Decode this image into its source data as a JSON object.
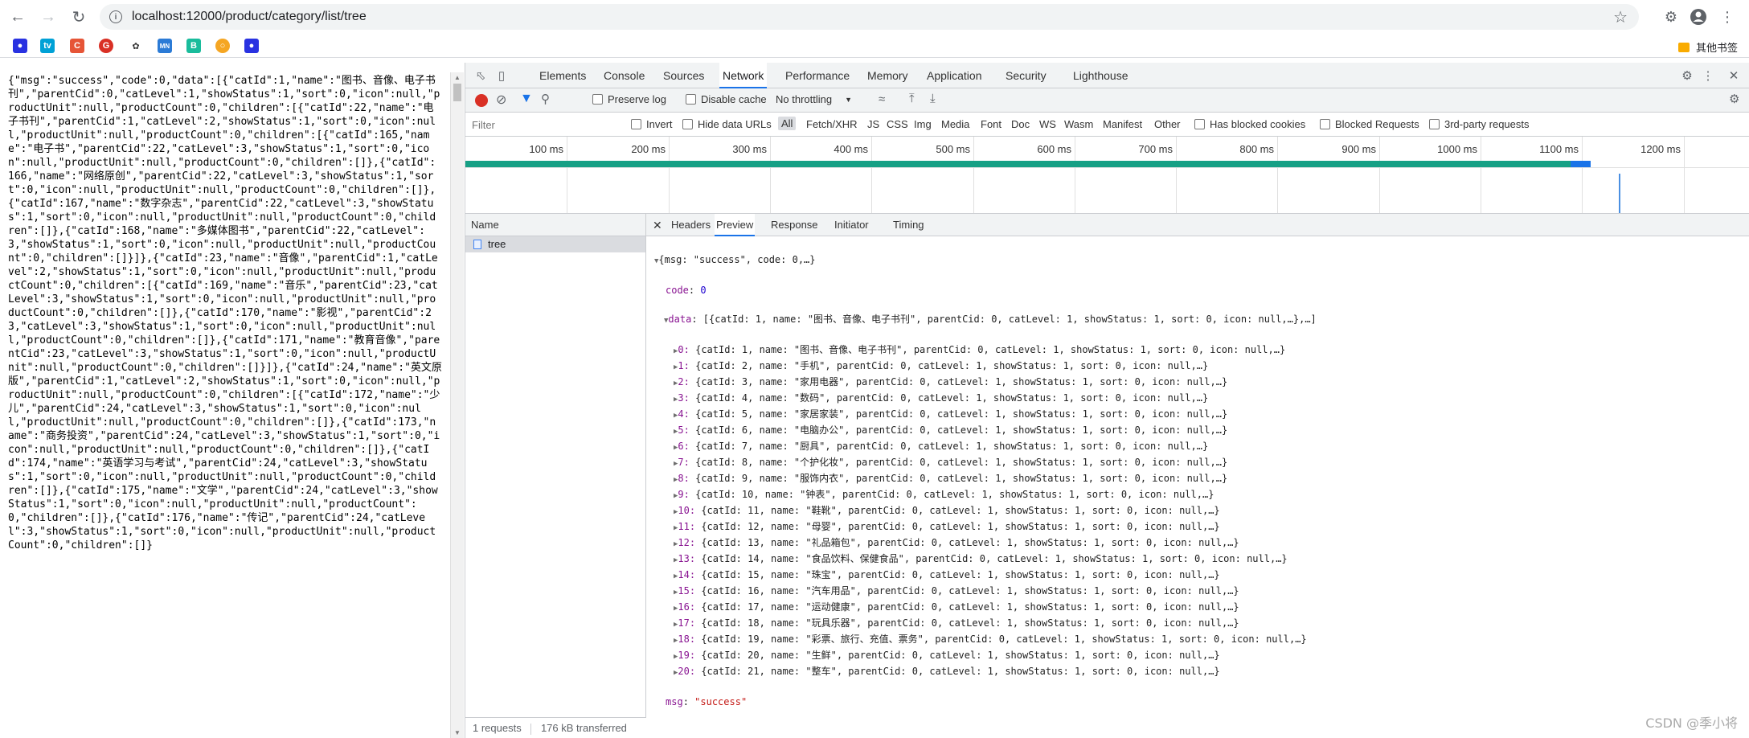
{
  "browser": {
    "url": "localhost:12000/product/category/list/tree",
    "other_bookmarks": "其他书签"
  },
  "page_json_text": "{\"msg\":\"success\",\"code\":0,\"data\":[{\"catId\":1,\"name\":\"图书、音像、电子书刊\",\"parentCid\":0,\"catLevel\":1,\"showStatus\":1,\"sort\":0,\"icon\":null,\"productUnit\":null,\"productCount\":0,\"children\":[{\"catId\":22,\"name\":\"电子书刊\",\"parentCid\":1,\"catLevel\":2,\"showStatus\":1,\"sort\":0,\"icon\":null,\"productUnit\":null,\"productCount\":0,\"children\":[{\"catId\":165,\"name\":\"电子书\",\"parentCid\":22,\"catLevel\":3,\"showStatus\":1,\"sort\":0,\"icon\":null,\"productUnit\":null,\"productCount\":0,\"children\":[]},{\"catId\":166,\"name\":\"网络原创\",\"parentCid\":22,\"catLevel\":3,\"showStatus\":1,\"sort\":0,\"icon\":null,\"productUnit\":null,\"productCount\":0,\"children\":[]},{\"catId\":167,\"name\":\"数字杂志\",\"parentCid\":22,\"catLevel\":3,\"showStatus\":1,\"sort\":0,\"icon\":null,\"productUnit\":null,\"productCount\":0,\"children\":[]},{\"catId\":168,\"name\":\"多媒体图书\",\"parentCid\":22,\"catLevel\":3,\"showStatus\":1,\"sort\":0,\"icon\":null,\"productUnit\":null,\"productCount\":0,\"children\":[]}]},{\"catId\":23,\"name\":\"音像\",\"parentCid\":1,\"catLevel\":2,\"showStatus\":1,\"sort\":0,\"icon\":null,\"productUnit\":null,\"productCount\":0,\"children\":[{\"catId\":169,\"name\":\"音乐\",\"parentCid\":23,\"catLevel\":3,\"showStatus\":1,\"sort\":0,\"icon\":null,\"productUnit\":null,\"productCount\":0,\"children\":[]},{\"catId\":170,\"name\":\"影视\",\"parentCid\":23,\"catLevel\":3,\"showStatus\":1,\"sort\":0,\"icon\":null,\"productUnit\":null,\"productCount\":0,\"children\":[]},{\"catId\":171,\"name\":\"教育音像\",\"parentCid\":23,\"catLevel\":3,\"showStatus\":1,\"sort\":0,\"icon\":null,\"productUnit\":null,\"productCount\":0,\"children\":[]}]},{\"catId\":24,\"name\":\"英文原版\",\"parentCid\":1,\"catLevel\":2,\"showStatus\":1,\"sort\":0,\"icon\":null,\"productUnit\":null,\"productCount\":0,\"children\":[{\"catId\":172,\"name\":\"少儿\",\"parentCid\":24,\"catLevel\":3,\"showStatus\":1,\"sort\":0,\"icon\":null,\"productUnit\":null,\"productCount\":0,\"children\":[]},{\"catId\":173,\"name\":\"商务投资\",\"parentCid\":24,\"catLevel\":3,\"showStatus\":1,\"sort\":0,\"icon\":null,\"productUnit\":null,\"productCount\":0,\"children\":[]},{\"catId\":174,\"name\":\"英语学习与考试\",\"parentCid\":24,\"catLevel\":3,\"showStatus\":1,\"sort\":0,\"icon\":null,\"productUnit\":null,\"productCount\":0,\"children\":[]},{\"catId\":175,\"name\":\"文学\",\"parentCid\":24,\"catLevel\":3,\"showStatus\":1,\"sort\":0,\"icon\":null,\"productUnit\":null,\"productCount\":0,\"children\":[]},{\"catId\":176,\"name\":\"传记\",\"parentCid\":24,\"catLevel\":3,\"showStatus\":1,\"sort\":0,\"icon\":null,\"productUnit\":null,\"productCount\":0,\"children\":[]}",
  "devtools": {
    "tabs": [
      "Elements",
      "Console",
      "Sources",
      "Network",
      "Performance",
      "Memory",
      "Application",
      "Security",
      "Lighthouse"
    ],
    "active_tab": "Network",
    "toolbar": {
      "preserve_log": "Preserve log",
      "disable_cache": "Disable cache",
      "throttling": "No throttling"
    },
    "filter": {
      "placeholder": "Filter",
      "invert": "Invert",
      "hide_data_urls": "Hide data URLs",
      "types": [
        "All",
        "Fetch/XHR",
        "JS",
        "CSS",
        "Img",
        "Media",
        "Font",
        "Doc",
        "WS",
        "Wasm",
        "Manifest",
        "Other"
      ],
      "has_blocked_cookies": "Has blocked cookies",
      "blocked_requests": "Blocked Requests",
      "third_party": "3rd-party requests"
    },
    "timeline_ticks": [
      "100 ms",
      "200 ms",
      "300 ms",
      "400 ms",
      "500 ms",
      "600 ms",
      "700 ms",
      "800 ms",
      "900 ms",
      "1000 ms",
      "1100 ms",
      "1200 ms"
    ],
    "name_header": "Name",
    "request_name": "tree",
    "summary": {
      "requests": "1 requests",
      "transferred": "176 kB transferred"
    },
    "preview_tabs": [
      "Headers",
      "Preview",
      "Response",
      "Initiator",
      "Timing"
    ],
    "preview": {
      "root": "{msg: \"success\", code: 0,…}",
      "code_key": "code",
      "code_val": "0",
      "data_key": "data",
      "data_summary": "[{catId: 1, name: \"图书、音像、电子书刊\", parentCid: 0, catLevel: 1, showStatus: 1, sort: 0, icon: null,…},…]",
      "items": [
        "{catId: 1, name: \"图书、音像、电子书刊\", parentCid: 0, catLevel: 1, showStatus: 1, sort: 0, icon: null,…}",
        "{catId: 2, name: \"手机\", parentCid: 0, catLevel: 1, showStatus: 1, sort: 0, icon: null,…}",
        "{catId: 3, name: \"家用电器\", parentCid: 0, catLevel: 1, showStatus: 1, sort: 0, icon: null,…}",
        "{catId: 4, name: \"数码\", parentCid: 0, catLevel: 1, showStatus: 1, sort: 0, icon: null,…}",
        "{catId: 5, name: \"家居家装\", parentCid: 0, catLevel: 1, showStatus: 1, sort: 0, icon: null,…}",
        "{catId: 6, name: \"电脑办公\", parentCid: 0, catLevel: 1, showStatus: 1, sort: 0, icon: null,…}",
        "{catId: 7, name: \"厨具\", parentCid: 0, catLevel: 1, showStatus: 1, sort: 0, icon: null,…}",
        "{catId: 8, name: \"个护化妆\", parentCid: 0, catLevel: 1, showStatus: 1, sort: 0, icon: null,…}",
        "{catId: 9, name: \"服饰内衣\", parentCid: 0, catLevel: 1, showStatus: 1, sort: 0, icon: null,…}",
        "{catId: 10, name: \"钟表\", parentCid: 0, catLevel: 1, showStatus: 1, sort: 0, icon: null,…}",
        "{catId: 11, name: \"鞋靴\", parentCid: 0, catLevel: 1, showStatus: 1, sort: 0, icon: null,…}",
        "{catId: 12, name: \"母婴\", parentCid: 0, catLevel: 1, showStatus: 1, sort: 0, icon: null,…}",
        "{catId: 13, name: \"礼品箱包\", parentCid: 0, catLevel: 1, showStatus: 1, sort: 0, icon: null,…}",
        "{catId: 14, name: \"食品饮料、保健食品\", parentCid: 0, catLevel: 1, showStatus: 1, sort: 0, icon: null,…}",
        "{catId: 15, name: \"珠宝\", parentCid: 0, catLevel: 1, showStatus: 1, sort: 0, icon: null,…}",
        "{catId: 16, name: \"汽车用品\", parentCid: 0, catLevel: 1, showStatus: 1, sort: 0, icon: null,…}",
        "{catId: 17, name: \"运动健康\", parentCid: 0, catLevel: 1, showStatus: 1, sort: 0, icon: null,…}",
        "{catId: 18, name: \"玩具乐器\", parentCid: 0, catLevel: 1, showStatus: 1, sort: 0, icon: null,…}",
        "{catId: 19, name: \"彩票、旅行、充值、票务\", parentCid: 0, catLevel: 1, showStatus: 1, sort: 0, icon: null,…}",
        "{catId: 20, name: \"生鲜\", parentCid: 0, catLevel: 1, showStatus: 1, sort: 0, icon: null,…}",
        "{catId: 21, name: \"整车\", parentCid: 0, catLevel: 1, showStatus: 1, sort: 0, icon: null,…}"
      ],
      "msg_key": "msg",
      "msg_val": "\"success\""
    }
  },
  "watermark": "CSDN @季小将"
}
